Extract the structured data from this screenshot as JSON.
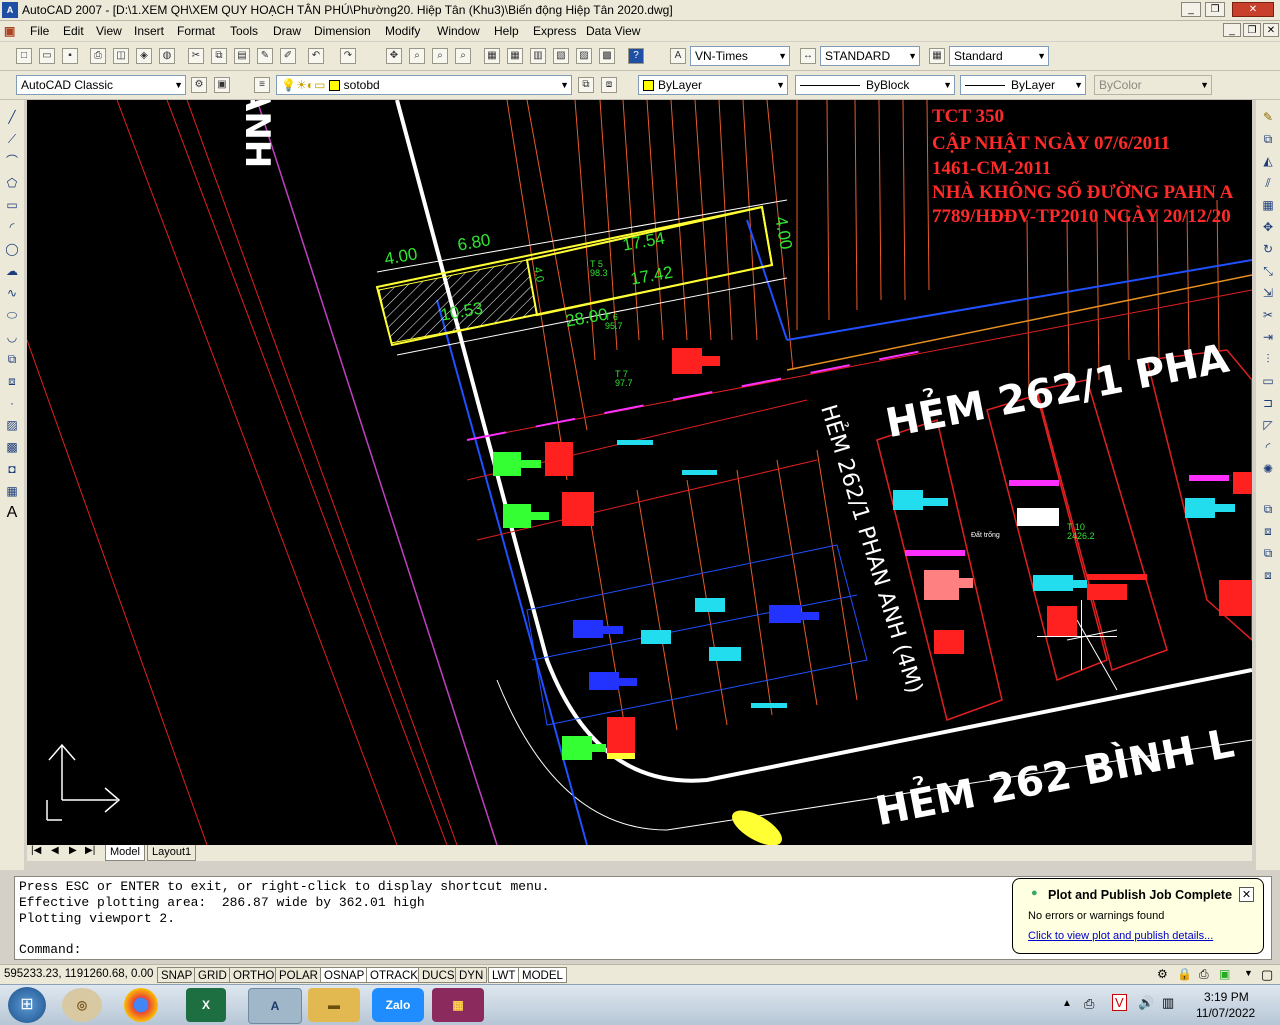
{
  "window": {
    "title": "AutoCAD 2007 - [D:\\1.XEM QH\\XEM QUY HOẠCH TÂN PHÚ\\Phường20. Hiệp Tân (Khu3)\\Biến động Hiệp Tân 2020.dwg]",
    "app_icon_text": "A"
  },
  "menu": [
    "File",
    "Edit",
    "View",
    "Insert",
    "Format",
    "Tools",
    "Draw",
    "Dimension",
    "Modify",
    "Window",
    "Help",
    "Express",
    "Data View"
  ],
  "toolbar1": {
    "text_style": "VN-Times",
    "dim_style": "STANDARD",
    "table_style": "Standard"
  },
  "toolbar2": {
    "workspace": "AutoCAD Classic",
    "layer": "sotobd",
    "color": "ByLayer",
    "linetype": "ByBlock",
    "lineweight": "ByLayer",
    "plotstyle": "ByColor"
  },
  "drawing": {
    "notes": [
      "TCT 350",
      "CẬP NHẬT NGÀY 07/6/2011",
      "1461-CM-2011",
      "NHÀ KHÔNG SỐ ĐƯỜNG PAHN A",
      "7789/HĐĐV-TP2010 NGÀY 20/12/20"
    ],
    "street_labels": {
      "hem_2621": "HẺM 262/1 PHA",
      "hem_2621_vertical": "HẺM 262/1 PHAN ANH (4M)",
      "hem_262": "HẺM 262 BÌNH L",
      "anh": "ANH"
    },
    "dimensions": [
      "4.00",
      "6.80",
      "17.54",
      "17.42",
      "4.00",
      "10.53",
      "28.00",
      "4.0"
    ],
    "parcels": [
      "T 5\n98.3",
      "T 6\n95.7",
      "T 7\n97.7",
      "T 10\n2426.2"
    ],
    "note_small": "Đất trống"
  },
  "tabs": {
    "model": "Model",
    "layout1": "Layout1"
  },
  "command": {
    "lines": [
      "Press ESC or ENTER to exit, or right-click to display shortcut menu.",
      "Effective plotting area:  286.87 wide by 362.01 high",
      "Plotting viewport 2."
    ],
    "prompt": "Command:"
  },
  "balloon": {
    "title": "Plot and Publish Job Complete",
    "message": "No errors or warnings found",
    "link": "Click to view plot and publish details..."
  },
  "status": {
    "coords": "595233.23, 1191260.68, 0.00",
    "buttons": [
      "SNAP",
      "GRID",
      "ORTHO",
      "POLAR",
      "OSNAP",
      "OTRACK",
      "DUCS",
      "DYN",
      "LWT",
      "MODEL"
    ],
    "active": [
      "OSNAP",
      "OTRACK",
      "LWT",
      "MODEL"
    ]
  },
  "taskbar": {
    "time": "3:19 PM",
    "date": "11/07/2022",
    "apps": [
      "start-button",
      "explorer-app",
      "chrome-app",
      "excel-app",
      "autocad-app",
      "folder-app",
      "zalo-app",
      "winrar-app"
    ],
    "zalo_label": "Zalo"
  }
}
